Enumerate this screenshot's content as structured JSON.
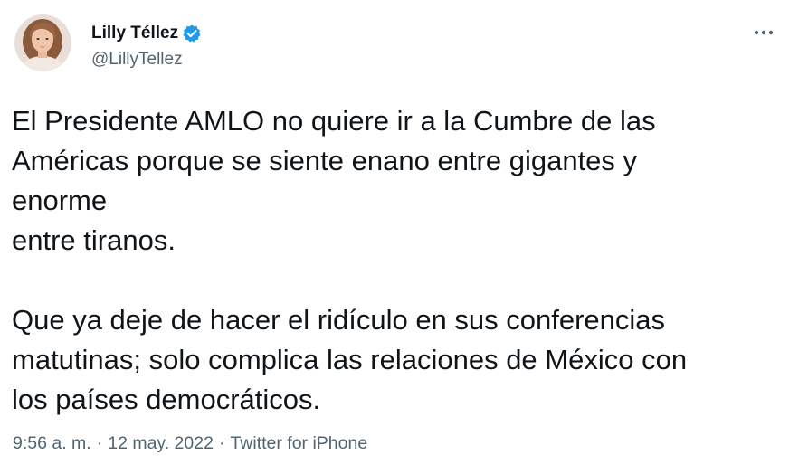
{
  "author": {
    "display_name": "Lilly Téllez",
    "handle": "@LillyTellez",
    "verified": true,
    "avatar": "profile-photo"
  },
  "tweet": {
    "paragraph1": [
      "El Presidente AMLO no quiere ir a la Cumbre de las",
      "Américas porque se siente enano entre gigantes y",
      "enorme",
      "entre tiranos."
    ],
    "paragraph2": [
      "Que ya deje de hacer el ridículo en sus conferencias",
      "matutinas; solo complica las relaciones de México con",
      "los países democráticos."
    ]
  },
  "meta": {
    "time": "9:56 a. m.",
    "separator": "·",
    "date": "12 may. 2022",
    "source": "Twitter for iPhone"
  },
  "icons": {
    "verified": "verified-badge-icon",
    "more": "more-options-icon"
  },
  "colors": {
    "text": "#0f1419",
    "secondary": "#536471",
    "verified": "#1d9bf0"
  }
}
